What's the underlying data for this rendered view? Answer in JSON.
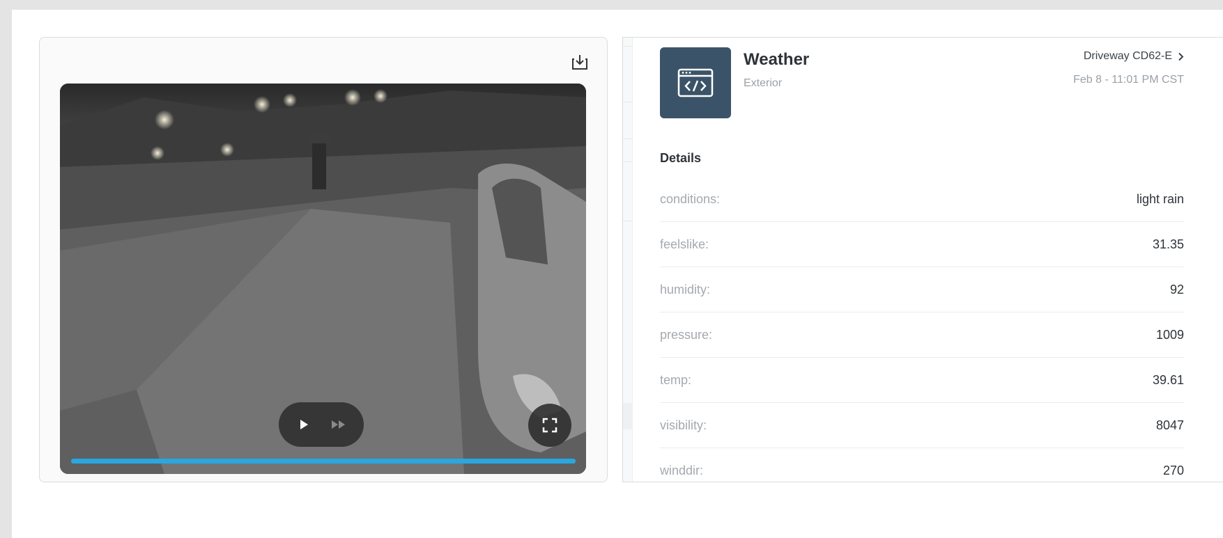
{
  "video": {
    "progress": 1.0,
    "accent_color": "#29a7e0",
    "icons": {
      "download": "download-icon",
      "play": "play-icon",
      "fast_forward": "fast-forward-icon",
      "fullscreen": "fullscreen-icon"
    }
  },
  "event": {
    "title": "Weather",
    "subtitle": "Exterior",
    "camera": "Driveway CD62-E",
    "timestamp": "Feb 8 - 11:01 PM CST",
    "app_icon": "code-window-icon",
    "tile_color": "#3b5368"
  },
  "details": {
    "heading": "Details",
    "rows": [
      {
        "key": "conditions:",
        "value": "light rain"
      },
      {
        "key": "feelslike:",
        "value": "31.35"
      },
      {
        "key": "humidity:",
        "value": "92"
      },
      {
        "key": "pressure:",
        "value": "1009"
      },
      {
        "key": "temp:",
        "value": "39.61"
      },
      {
        "key": "visibility:",
        "value": "8047"
      },
      {
        "key": "winddir:",
        "value": "270"
      }
    ]
  }
}
